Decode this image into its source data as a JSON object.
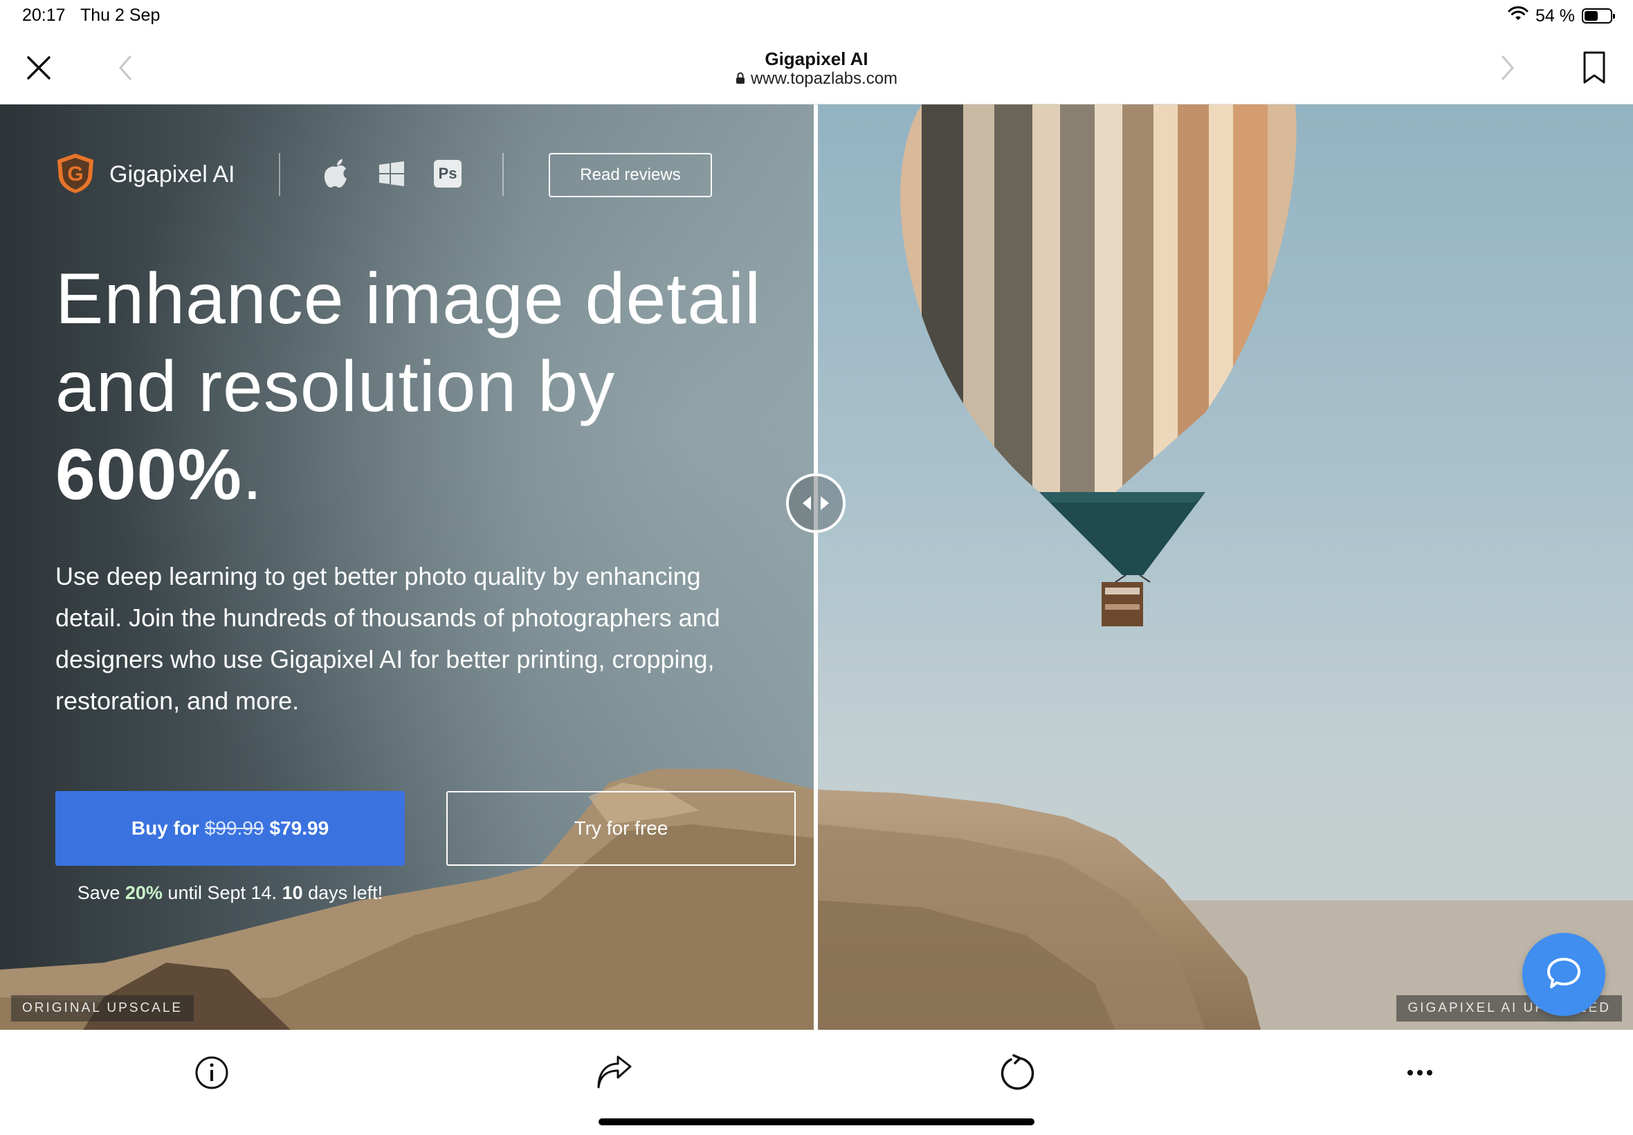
{
  "status_bar": {
    "time": "20:17",
    "date": "Thu 2 Sep",
    "battery_text": "54 %",
    "battery_level": 0.54
  },
  "browser": {
    "page_title": "Gigapixel AI",
    "url": "www.topazlabs.com",
    "icons": {
      "close": "close-icon",
      "back": "chevron-left-icon",
      "forward": "chevron-right-icon",
      "bookmark": "bookmark-icon"
    }
  },
  "hero": {
    "brand_name": "Gigapixel AI",
    "brand_logo_letter": "G",
    "platforms": [
      "apple-icon",
      "windows-icon",
      "photoshop-icon"
    ],
    "ps_badge": "Ps",
    "read_reviews_label": "Read reviews",
    "headline_line1": "Enhance image detail",
    "headline_line2": "and resolution by",
    "headline_highlight": "600%",
    "headline_end": ".",
    "subtext": "Use deep learning to get better photo quality by enhancing detail. Join the hundreds of thousands of photographers and designers who use Gigapixel AI for better printing, cropping, restoration, and more.",
    "buy_prefix": "Buy for",
    "buy_old_price": "$99.99",
    "buy_new_price": "$79.99",
    "try_label": "Try for free",
    "save_prefix": "Save",
    "save_percent": "20%",
    "save_middle": "until Sept 14.",
    "save_days": "10",
    "save_suffix": "days left!",
    "label_left": "ORIGINAL UPSCALE",
    "label_right": "GIGAPIXEL AI UPSCALED"
  },
  "colors": {
    "buy_button": "#3a72e0",
    "chat_button": "#3f8ef0",
    "logo_orange": "#e8742a"
  },
  "bottom_toolbar": {
    "icons": [
      "info-icon",
      "share-icon",
      "reload-icon",
      "more-icon"
    ]
  }
}
